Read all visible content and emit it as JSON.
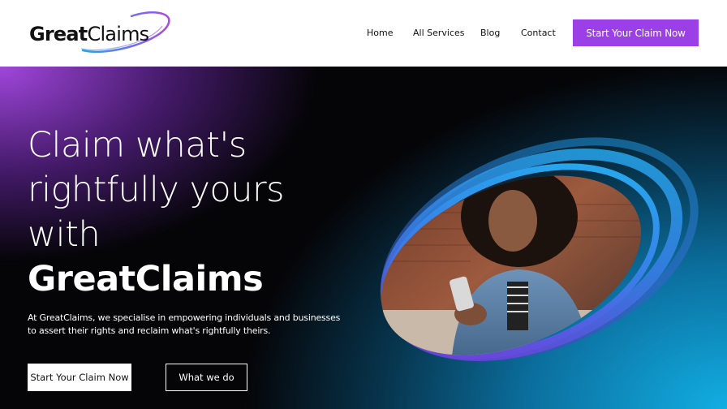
{
  "brand": {
    "name_part1": "Great",
    "name_part2": "Claims",
    "colors": {
      "purple": "#9b3fe6",
      "blue": "#1ba7e0",
      "dark": "#050508"
    }
  },
  "nav": {
    "items": [
      {
        "label": "Home"
      },
      {
        "label": "All Services"
      },
      {
        "label": "Blog"
      },
      {
        "label": "Contact"
      }
    ],
    "cta_label": "Start Your Claim Now"
  },
  "hero": {
    "title_lines": [
      "Claim what's",
      "rightfully yours",
      "with"
    ],
    "title_brand": "GreatClaims",
    "description_line1": "At GreatClaims, we specialise in empowering individuals and businesses",
    "description_line2": "to assert their rights and reclaim what's rightfully theirs.",
    "primary_button": "Start Your Claim Now",
    "secondary_button": "What we do",
    "image_subject": "woman-using-smartphone-photo"
  }
}
